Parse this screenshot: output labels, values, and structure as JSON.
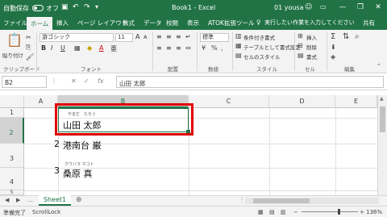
{
  "window": {
    "autosave_label": "自動保存",
    "autosave_state": "オフ",
    "title": "Book1  -  Excel",
    "user": "01 yousa",
    "user_icon": "smiley-icon",
    "minimize": "—",
    "restore": "❐",
    "close": "✕"
  },
  "tabs": [
    "ファイル",
    "ホーム",
    "挿入",
    "ページ レイアウト",
    "数式",
    "データ",
    "校閲",
    "表示",
    "ATOK拡張ツール"
  ],
  "active_tab": "ホーム",
  "tell_me": "実行したい作業を入力してください",
  "share": "共有",
  "ribbon": {
    "paste_label": "貼り付け",
    "clipboard": "クリップボード",
    "font_name": "游ゴシック",
    "font_size": "11",
    "bold": "B",
    "italic": "I",
    "underline": "U",
    "grow": "A",
    "shrink": "A",
    "phonetic": "亜",
    "font_group": "フォント",
    "align_group": "配置",
    "number_format": "標準",
    "number_group": "数値",
    "styles_cond": "条件付き書式",
    "styles_table": "テーブルとして書式設定",
    "styles_cell": "セルのスタイル",
    "styles_group": "スタイル",
    "cells_insert": "挿入",
    "cells_delete": "削除",
    "cells_format": "書式",
    "cells_group": "セル",
    "edit_group": "編集"
  },
  "formula_bar": {
    "name_box": "B2",
    "cancel": "✕",
    "enter": "✓",
    "fx": "fx",
    "value": "山田 太郎"
  },
  "sheet": {
    "columns": [
      "A",
      "B",
      "C",
      "D",
      "E"
    ],
    "rows": [
      "1",
      "2",
      "3",
      "4",
      "5"
    ],
    "cells": [
      {
        "row": "2",
        "furigana": "やまだ　たろう",
        "value": "山田 太郎"
      },
      {
        "row": "3",
        "num": "2",
        "furigana": "",
        "value": "港南台 巌"
      },
      {
        "row": "4",
        "num": "3",
        "furigana": "クワハラ マコト",
        "value": "桑原 真"
      }
    ],
    "highlight_color": "#e00000",
    "accent": "#217346"
  },
  "sheet_tabs": [
    "Sheet1"
  ],
  "add_sheet": "⊕",
  "status": {
    "ready": "準備完了",
    "scroll_lock": "ScrollLock",
    "zoom": "136%",
    "zoom_minus": "−",
    "zoom_plus": "+"
  }
}
